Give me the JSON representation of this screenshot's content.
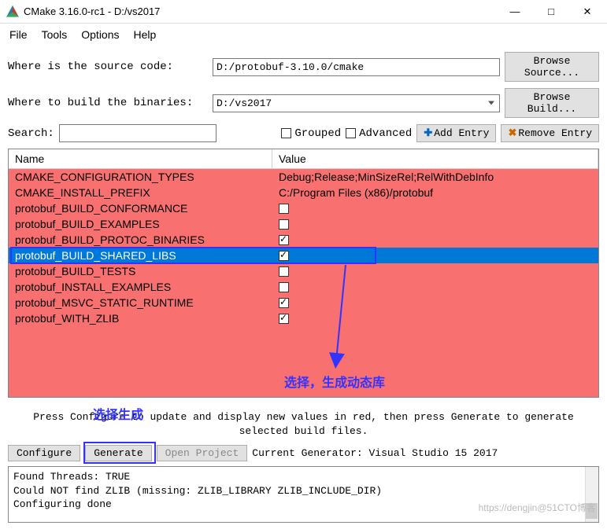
{
  "window": {
    "title": "CMake 3.16.0-rc1 - D:/vs2017",
    "min": "—",
    "max": "□",
    "close": "✕"
  },
  "menu": {
    "file": "File",
    "tools": "Tools",
    "options": "Options",
    "help": "Help"
  },
  "source": {
    "label": "Where is the source code:",
    "value": "D:/protobuf-3.10.0/cmake",
    "browse": "Browse Source..."
  },
  "build": {
    "label": "Where to build the binaries:",
    "value": "D:/vs2017",
    "browse": "Browse Build..."
  },
  "search": {
    "label": "Search:",
    "value": ""
  },
  "flags": {
    "grouped": "Grouped",
    "advanced": "Advanced"
  },
  "entry_btns": {
    "add": "Add Entry",
    "remove": "Remove Entry"
  },
  "table": {
    "hdr_name": "Name",
    "hdr_value": "Value",
    "rows": [
      {
        "name": "CMAKE_CONFIGURATION_TYPES",
        "value": "Debug;Release;MinSizeRel;RelWithDebInfo",
        "type": "text"
      },
      {
        "name": "CMAKE_INSTALL_PREFIX",
        "value": "C:/Program Files (x86)/protobuf",
        "type": "text"
      },
      {
        "name": "protobuf_BUILD_CONFORMANCE",
        "value": false,
        "type": "bool"
      },
      {
        "name": "protobuf_BUILD_EXAMPLES",
        "value": false,
        "type": "bool"
      },
      {
        "name": "protobuf_BUILD_PROTOC_BINARIES",
        "value": true,
        "type": "bool"
      },
      {
        "name": "protobuf_BUILD_SHARED_LIBS",
        "value": true,
        "type": "bool",
        "selected": true
      },
      {
        "name": "protobuf_BUILD_TESTS",
        "value": false,
        "type": "bool"
      },
      {
        "name": "protobuf_INSTALL_EXAMPLES",
        "value": false,
        "type": "bool"
      },
      {
        "name": "protobuf_MSVC_STATIC_RUNTIME",
        "value": true,
        "type": "bool"
      },
      {
        "name": "protobuf_WITH_ZLIB",
        "value": true,
        "type": "bool"
      }
    ]
  },
  "annotations": {
    "select_dynamic": "选择，生成动态库",
    "select_generate": "选择生成"
  },
  "hint": "Press Configure to update and display new values in red, then press Generate to generate selected build files.",
  "buttons": {
    "configure": "Configure",
    "generate": "Generate",
    "open_project": "Open Project",
    "generator_label": "Current Generator: Visual Studio 15 2017"
  },
  "log": {
    "line1": "Found Threads: TRUE",
    "line2": "Could NOT find ZLIB (missing: ZLIB_LIBRARY ZLIB_INCLUDE_DIR)",
    "line3": "Configuring done"
  },
  "watermark": "https://dengjin@51CTO博客"
}
